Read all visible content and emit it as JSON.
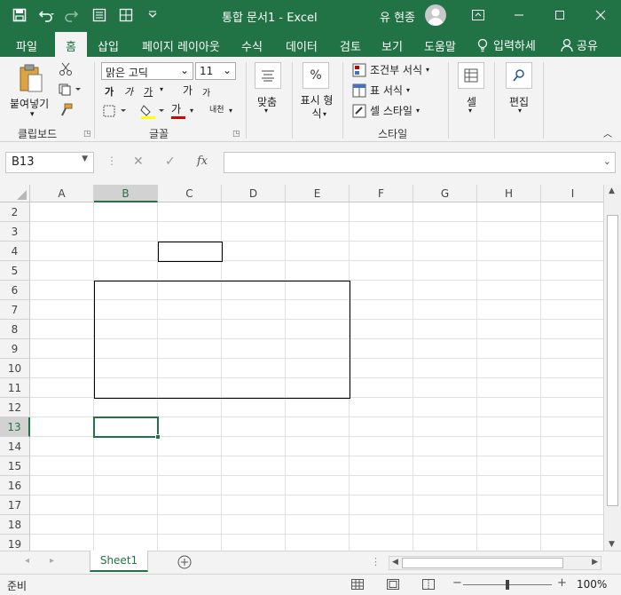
{
  "title_bar": {
    "document_title": "통합 문서1  -  Excel",
    "user_name": "유 현종",
    "save_icon": "save-icon",
    "undo_icon": "undo-icon",
    "redo_icon": "redo-icon",
    "form_icon": "form-icon",
    "table_icon": "table-icon",
    "customize_icon": "chevron-down-icon"
  },
  "ribbon_tabs": [
    {
      "label": "파일"
    },
    {
      "label": "홈"
    },
    {
      "label": "삽입"
    },
    {
      "label": "페이지 레이아웃"
    },
    {
      "label": "수식"
    },
    {
      "label": "데이터"
    },
    {
      "label": "검토"
    },
    {
      "label": "보기"
    },
    {
      "label": "도움말"
    },
    {
      "label": "입력하세"
    },
    {
      "label": "공유"
    }
  ],
  "ribbon": {
    "clipboard": {
      "paste": "붙여넣기",
      "group": "클립보드"
    },
    "font": {
      "name": "맑은 고딕",
      "size": "11",
      "group": "글꼴",
      "bold": "가",
      "italic": "가",
      "underline": "가",
      "grow": "가",
      "shrink": "가",
      "color_letter": "가",
      "phonetic": "내천"
    },
    "alignment": {
      "label": "맞춤"
    },
    "number": {
      "label": "표시 형식",
      "percent": "%"
    },
    "styles": {
      "conditional": "조건부 서식",
      "table": "표 서식",
      "cell_styles": "셀 스타일",
      "group": "스타일"
    },
    "cells": {
      "label": "셀"
    },
    "editing": {
      "label": "편집"
    }
  },
  "formula_bar": {
    "name_box": "B13",
    "fx": "fx",
    "formula": ""
  },
  "grid": {
    "columns": [
      "A",
      "B",
      "C",
      "D",
      "E",
      "F",
      "G",
      "H",
      "I"
    ],
    "rows": [
      "2",
      "3",
      "4",
      "5",
      "6",
      "7",
      "8",
      "9",
      "10",
      "11",
      "12",
      "13",
      "14",
      "15",
      "16",
      "17",
      "18",
      "19"
    ],
    "selected_cell": "B13",
    "bordered_ranges": [
      "C4",
      "B6:E11"
    ]
  },
  "sheets": {
    "tabs": [
      "Sheet1"
    ],
    "active": "Sheet1"
  },
  "status_bar": {
    "status": "준비",
    "zoom": "100%"
  },
  "colors": {
    "accent": "#217346",
    "ribbon_bg": "#f3f3f3"
  }
}
